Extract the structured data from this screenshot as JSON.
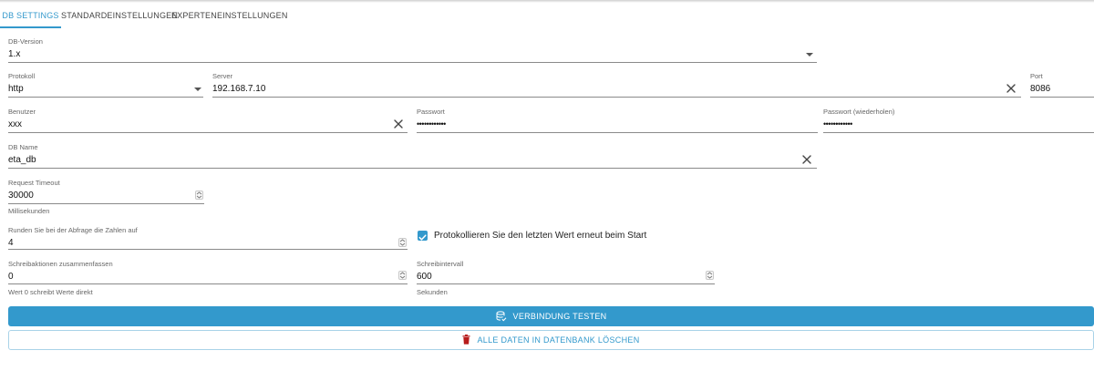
{
  "tabs": [
    {
      "label": "DB SETTINGS",
      "active": true
    },
    {
      "label": "STANDARDEINSTELLUNGEN",
      "active": false
    },
    {
      "label": "EXPERTENEINSTELLUNGEN",
      "active": false
    }
  ],
  "db_version": {
    "label": "DB-Version",
    "value": "1.x"
  },
  "protocol": {
    "label": "Protokoll",
    "value": "http"
  },
  "server": {
    "label": "Server",
    "value": "192.168.7.10"
  },
  "port": {
    "label": "Port",
    "value": "8086"
  },
  "user": {
    "label": "Benutzer",
    "value": "xxx"
  },
  "password": {
    "label": "Passwort",
    "value": "••••••••••••"
  },
  "password_repeat": {
    "label": "Passwort (wiederholen)",
    "value": "••••••••••••"
  },
  "db_name": {
    "label": "DB Name",
    "value": "eta_db"
  },
  "request_timeout": {
    "label": "Request Timeout",
    "value": "30000",
    "helper": "Millisekunden"
  },
  "round": {
    "label": "Runden Sie bei der Abfrage die Zahlen auf",
    "value": "4"
  },
  "log_last_value": {
    "label": "Protokollieren Sie den letzten Wert erneut beim Start",
    "checked": true
  },
  "write_batch": {
    "label": "Schreibaktionen zusammenfassen",
    "value": "0",
    "helper": "Wert 0 schreibt Werte direkt"
  },
  "write_interval": {
    "label": "Schreibintervall",
    "value": "600",
    "helper": "Sekunden"
  },
  "buttons": {
    "test_connection": "VERBINDUNG TESTEN",
    "delete_all": "ALLE DATEN IN DATENBANK LÖSCHEN"
  },
  "colors": {
    "accent": "#3399cc",
    "danger": "#b71c1c"
  }
}
